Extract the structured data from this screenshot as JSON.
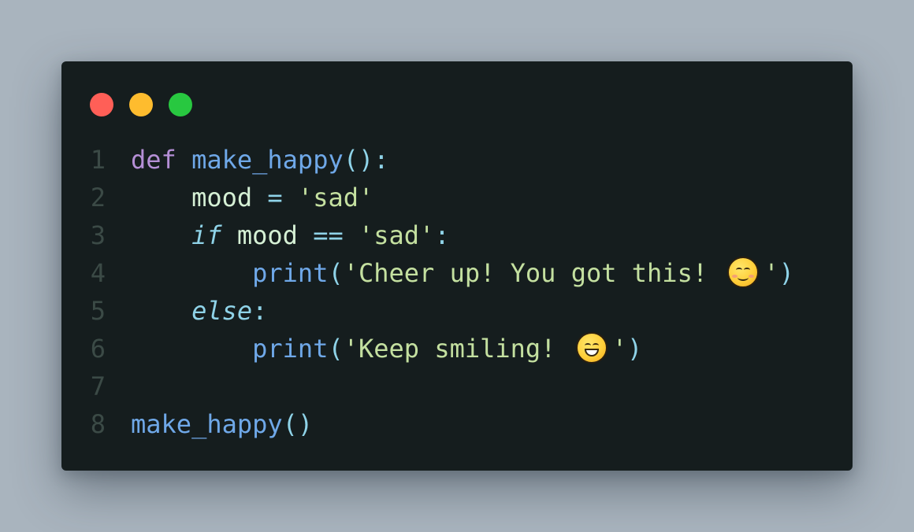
{
  "window": {
    "controls": [
      {
        "name": "close",
        "color": "#ff5f57"
      },
      {
        "name": "minimize",
        "color": "#febc2e"
      },
      {
        "name": "maximize",
        "color": "#28c840"
      }
    ]
  },
  "code": {
    "language": "python",
    "lines": [
      {
        "number": "1",
        "tokens": [
          {
            "type": "kw",
            "text": "def"
          },
          {
            "type": "plain",
            "text": " "
          },
          {
            "type": "fn",
            "text": "make_happy"
          },
          {
            "type": "punc",
            "text": "():"
          }
        ]
      },
      {
        "number": "2",
        "tokens": [
          {
            "type": "plain",
            "text": "    "
          },
          {
            "type": "var",
            "text": "mood"
          },
          {
            "type": "plain",
            "text": " "
          },
          {
            "type": "op",
            "text": "="
          },
          {
            "type": "plain",
            "text": " "
          },
          {
            "type": "str",
            "text": "'sad'"
          }
        ]
      },
      {
        "number": "3",
        "tokens": [
          {
            "type": "plain",
            "text": "    "
          },
          {
            "type": "kwi",
            "text": "if"
          },
          {
            "type": "plain",
            "text": " "
          },
          {
            "type": "var",
            "text": "mood"
          },
          {
            "type": "plain",
            "text": " "
          },
          {
            "type": "op",
            "text": "=="
          },
          {
            "type": "plain",
            "text": " "
          },
          {
            "type": "str",
            "text": "'sad'"
          },
          {
            "type": "punc",
            "text": ":"
          }
        ]
      },
      {
        "number": "4",
        "tokens": [
          {
            "type": "plain",
            "text": "        "
          },
          {
            "type": "fn",
            "text": "print"
          },
          {
            "type": "punc",
            "text": "("
          },
          {
            "type": "str",
            "text": "'Cheer up! You got this! "
          },
          {
            "type": "emoji",
            "text": "smiling-face-with-smiling-eyes"
          },
          {
            "type": "str",
            "text": "'"
          },
          {
            "type": "punc",
            "text": ")"
          }
        ]
      },
      {
        "number": "5",
        "tokens": [
          {
            "type": "plain",
            "text": "    "
          },
          {
            "type": "kwi",
            "text": "else"
          },
          {
            "type": "punc",
            "text": ":"
          }
        ]
      },
      {
        "number": "6",
        "tokens": [
          {
            "type": "plain",
            "text": "        "
          },
          {
            "type": "fn",
            "text": "print"
          },
          {
            "type": "punc",
            "text": "("
          },
          {
            "type": "str",
            "text": "'Keep smiling! "
          },
          {
            "type": "emoji",
            "text": "grinning-face-with-smiling-eyes"
          },
          {
            "type": "str",
            "text": "'"
          },
          {
            "type": "punc",
            "text": ")"
          }
        ]
      },
      {
        "number": "7",
        "tokens": []
      },
      {
        "number": "8",
        "tokens": [
          {
            "type": "fn",
            "text": "make_happy"
          },
          {
            "type": "punc",
            "text": "()"
          }
        ]
      }
    ]
  }
}
